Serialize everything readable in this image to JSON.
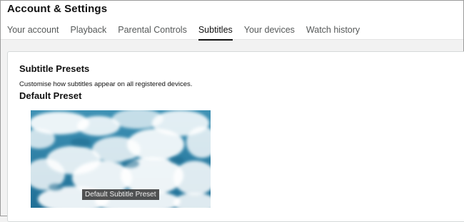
{
  "header": {
    "title": "Account & Settings",
    "tabs": [
      {
        "label": "Your account",
        "active": false
      },
      {
        "label": "Playback",
        "active": false
      },
      {
        "label": "Parental Controls",
        "active": false
      },
      {
        "label": "Subtitles",
        "active": true
      },
      {
        "label": "Your devices",
        "active": false
      },
      {
        "label": "Watch history",
        "active": false
      }
    ]
  },
  "main": {
    "section_title": "Subtitle Presets",
    "section_description": "Customise how subtitles appear on all registered devices.",
    "preset_name": "Default Preset",
    "preview_caption": "Default Subtitle Preset"
  },
  "colors": {
    "sky": "#2e7fa3",
    "caption_background": "#232323",
    "active_tab_underline": "#111111"
  }
}
